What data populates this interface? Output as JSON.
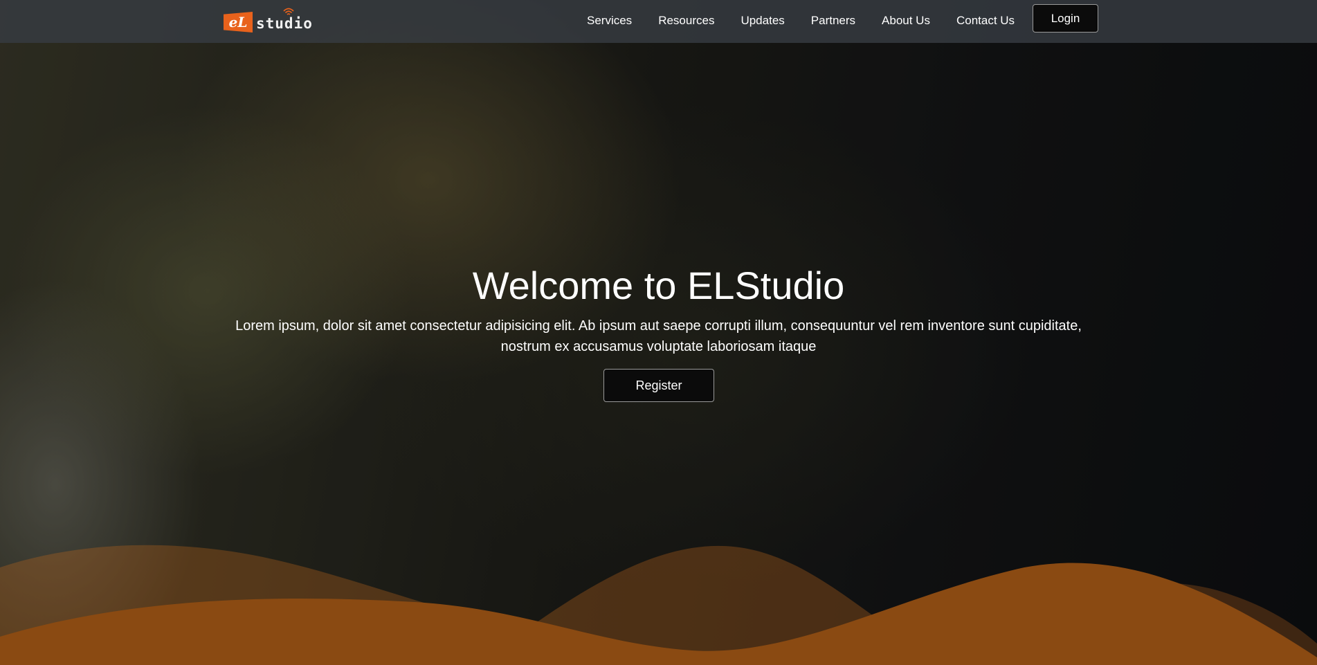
{
  "colors": {
    "accent": "#e8621c",
    "wave": "#8a4a12",
    "button_bg": "#0b0b0b",
    "nav_bg": "#373c42"
  },
  "logo": {
    "badge_text": "eL",
    "word": "studio",
    "icon": "wifi-icon"
  },
  "nav": {
    "links": [
      "Services",
      "Resources",
      "Updates",
      "Partners",
      "About Us",
      "Contact Us"
    ],
    "login_label": "Login"
  },
  "hero": {
    "title": "Welcome to ELStudio",
    "text": "Lorem ipsum, dolor sit amet consectetur adipisicing elit. Ab ipsum aut saepe corrupti illum, consequuntur vel rem inventore sunt cupiditate, nostrum ex accusamus voluptate laboriosam itaque",
    "register_label": "Register"
  }
}
